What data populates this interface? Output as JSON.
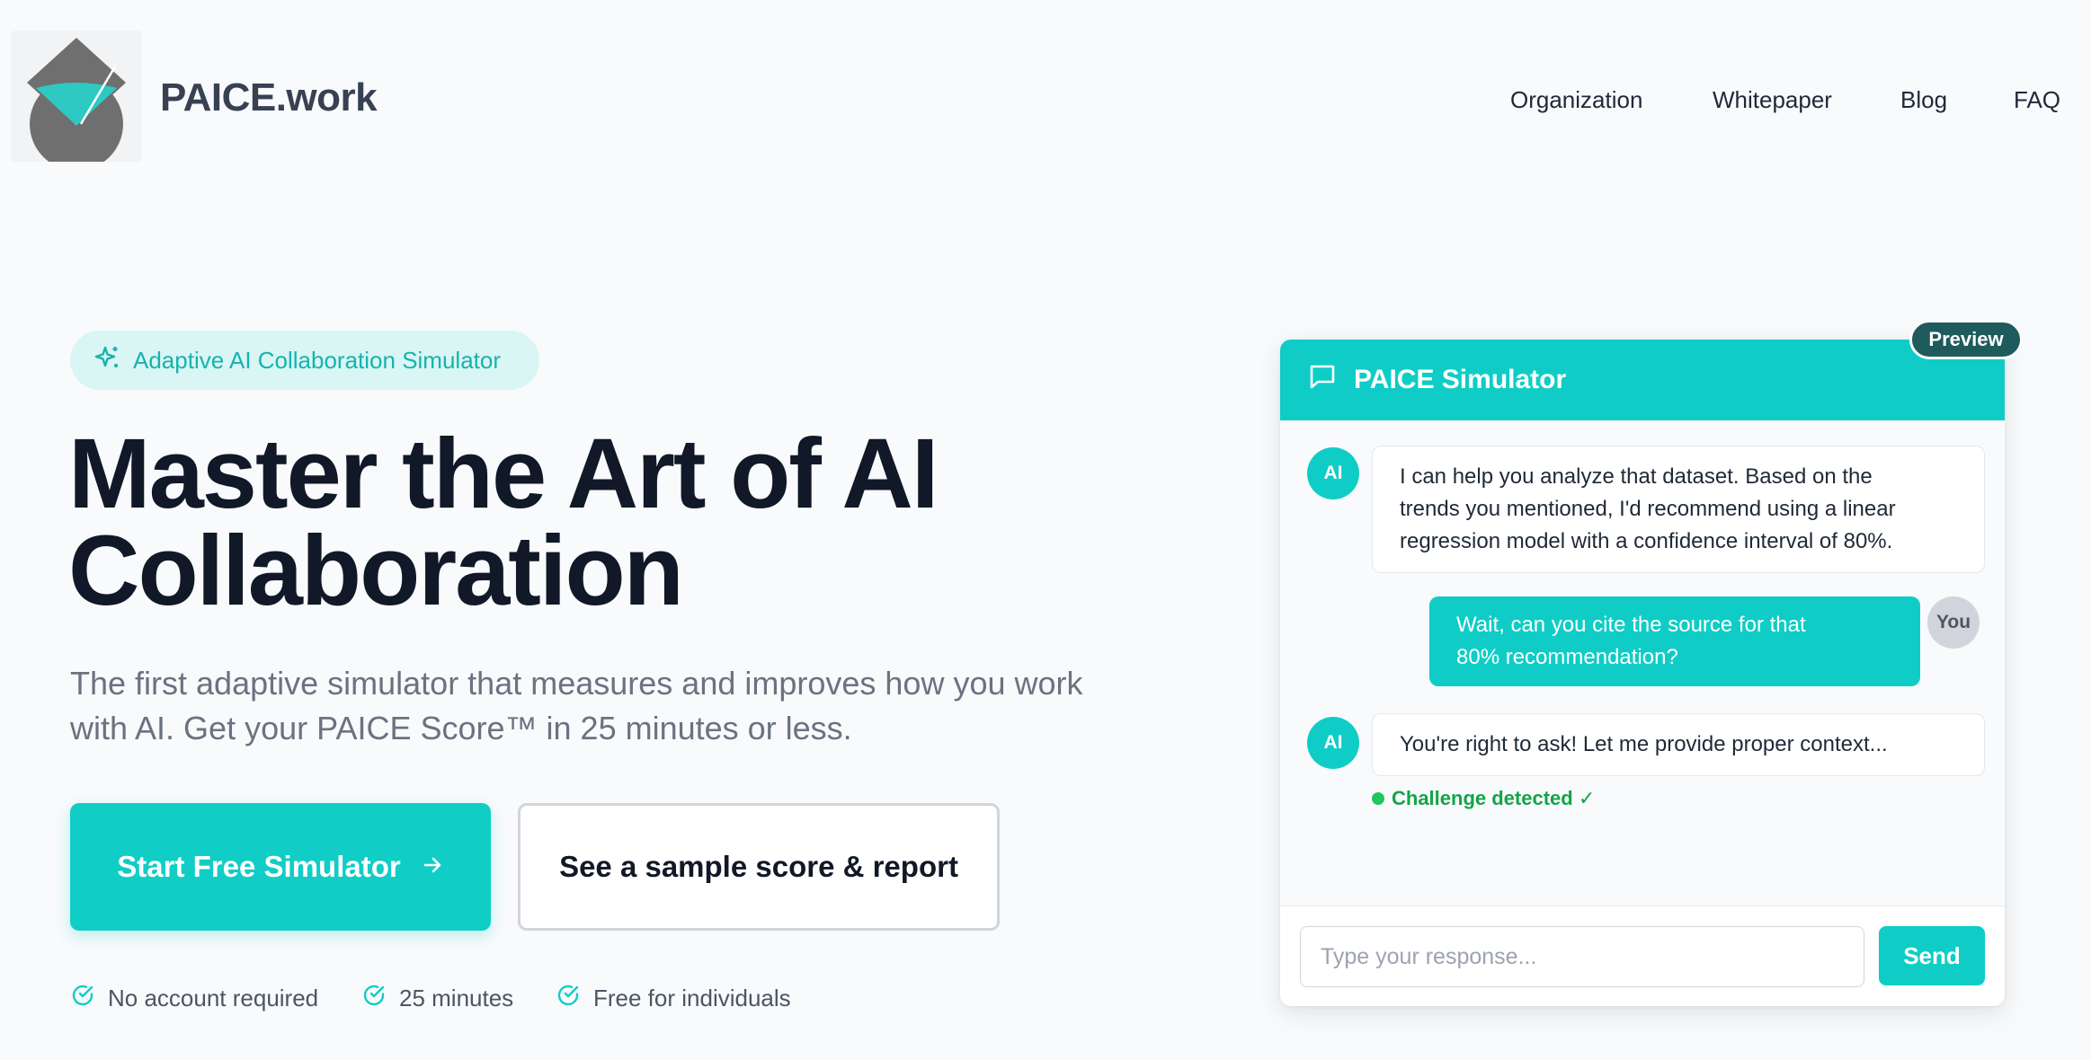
{
  "header": {
    "brand": "PAICE.work",
    "nav": [
      "Organization",
      "Whitepaper",
      "Blog",
      "FAQ"
    ]
  },
  "hero": {
    "badge": "Adaptive AI Collaboration Simulator",
    "headline_line1": "Master the Art of AI",
    "headline_line2": "Collaboration",
    "sub_line1": "The first adaptive simulator that measures and improves how you work",
    "sub_line2": "with AI. Get your PAICE Score™ in 25 minutes or less.",
    "primary_button": "Start Free Simulator",
    "secondary_button": "See a sample score & report",
    "features": [
      "No account required",
      "25 minutes",
      "Free for individuals"
    ]
  },
  "chat": {
    "preview_tag": "Preview",
    "title": "PAICE Simulator",
    "ai_label": "AI",
    "you_label": "You",
    "messages": [
      {
        "from": "ai",
        "text_lines": [
          "I can help you analyze that dataset. Based on the",
          "trends you mentioned, I'd recommend using a linear",
          "regression model with a confidence interval of 80%."
        ]
      },
      {
        "from": "you",
        "text_lines": [
          "Wait, can you cite the source for that",
          "80% recommendation?"
        ]
      },
      {
        "from": "ai",
        "text_lines": [
          "You're right to ask! Let me provide proper context..."
        ]
      }
    ],
    "challenge": "Challenge detected ✓",
    "input_placeholder": "Type your response...",
    "send_label": "Send"
  },
  "colors": {
    "accent": "#0fcdc6",
    "dark_teal": "#1f5a5d",
    "success": "#16a34a"
  },
  "icons": [
    "logo-icon",
    "sparkle-icon",
    "arrow-right-icon",
    "check-circle-icon",
    "chat-bubble-icon"
  ]
}
